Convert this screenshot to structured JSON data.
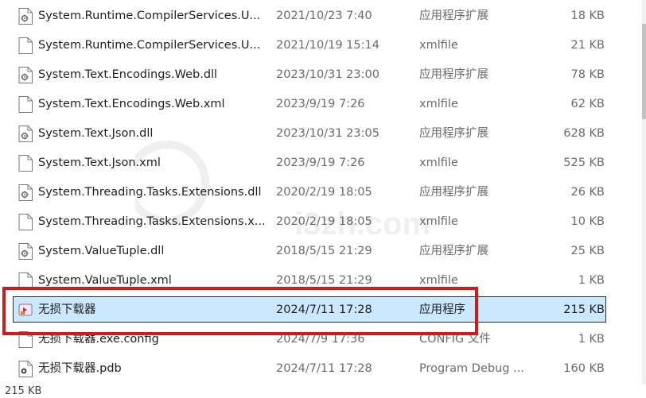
{
  "files": [
    {
      "name": "System.Runtime.CompilerServices.U...",
      "date": "2021/10/23 7:40",
      "type": "应用程序扩展",
      "size": "18 KB",
      "icon": "dll-icon"
    },
    {
      "name": "System.Runtime.CompilerServices.U...",
      "date": "2021/10/19 15:14",
      "type": "xmlfile",
      "size": "21 KB",
      "icon": "document-icon"
    },
    {
      "name": "System.Text.Encodings.Web.dll",
      "date": "2023/10/31 23:00",
      "type": "应用程序扩展",
      "size": "78 KB",
      "icon": "dll-icon"
    },
    {
      "name": "System.Text.Encodings.Web.xml",
      "date": "2023/9/19 7:26",
      "type": "xmlfile",
      "size": "62 KB",
      "icon": "document-icon"
    },
    {
      "name": "System.Text.Json.dll",
      "date": "2023/10/31 23:05",
      "type": "应用程序扩展",
      "size": "628 KB",
      "icon": "dll-icon"
    },
    {
      "name": "System.Text.Json.xml",
      "date": "2023/9/19 7:26",
      "type": "xmlfile",
      "size": "525 KB",
      "icon": "document-icon"
    },
    {
      "name": "System.Threading.Tasks.Extensions.dll",
      "date": "2020/2/19 18:05",
      "type": "应用程序扩展",
      "size": "26 KB",
      "icon": "dll-icon"
    },
    {
      "name": "System.Threading.Tasks.Extensions.x...",
      "date": "2020/2/19 18:05",
      "type": "xmlfile",
      "size": "10 KB",
      "icon": "document-icon"
    },
    {
      "name": "System.ValueTuple.dll",
      "date": "2018/5/15 21:29",
      "type": "应用程序扩展",
      "size": "25 KB",
      "icon": "dll-icon"
    },
    {
      "name": "System.ValueTuple.xml",
      "date": "2018/5/15 21:29",
      "type": "xmlfile",
      "size": "1 KB",
      "icon": "document-icon"
    },
    {
      "name": "无损下载器",
      "date": "2024/7/11 17:28",
      "type": "应用程序",
      "size": "215 KB",
      "icon": "exe-icon",
      "selected": true
    },
    {
      "name": "无损下载器.exe.config",
      "date": "2024/7/9 17:36",
      "type": "CONFIG 文件",
      "size": "1 KB",
      "icon": "document-icon"
    },
    {
      "name": "无损下载器.pdb",
      "date": "2024/7/11 17:28",
      "type": "Program Debug ...",
      "size": "160 KB",
      "icon": "pdb-icon"
    }
  ],
  "status": {
    "selected_size": "215 KB"
  },
  "watermark": {
    "text": "i3zh.com"
  },
  "colors": {
    "selection_bg": "#cce8ff",
    "highlight_border": "#c81e1e",
    "secondary_text": "#6b6b6b"
  }
}
